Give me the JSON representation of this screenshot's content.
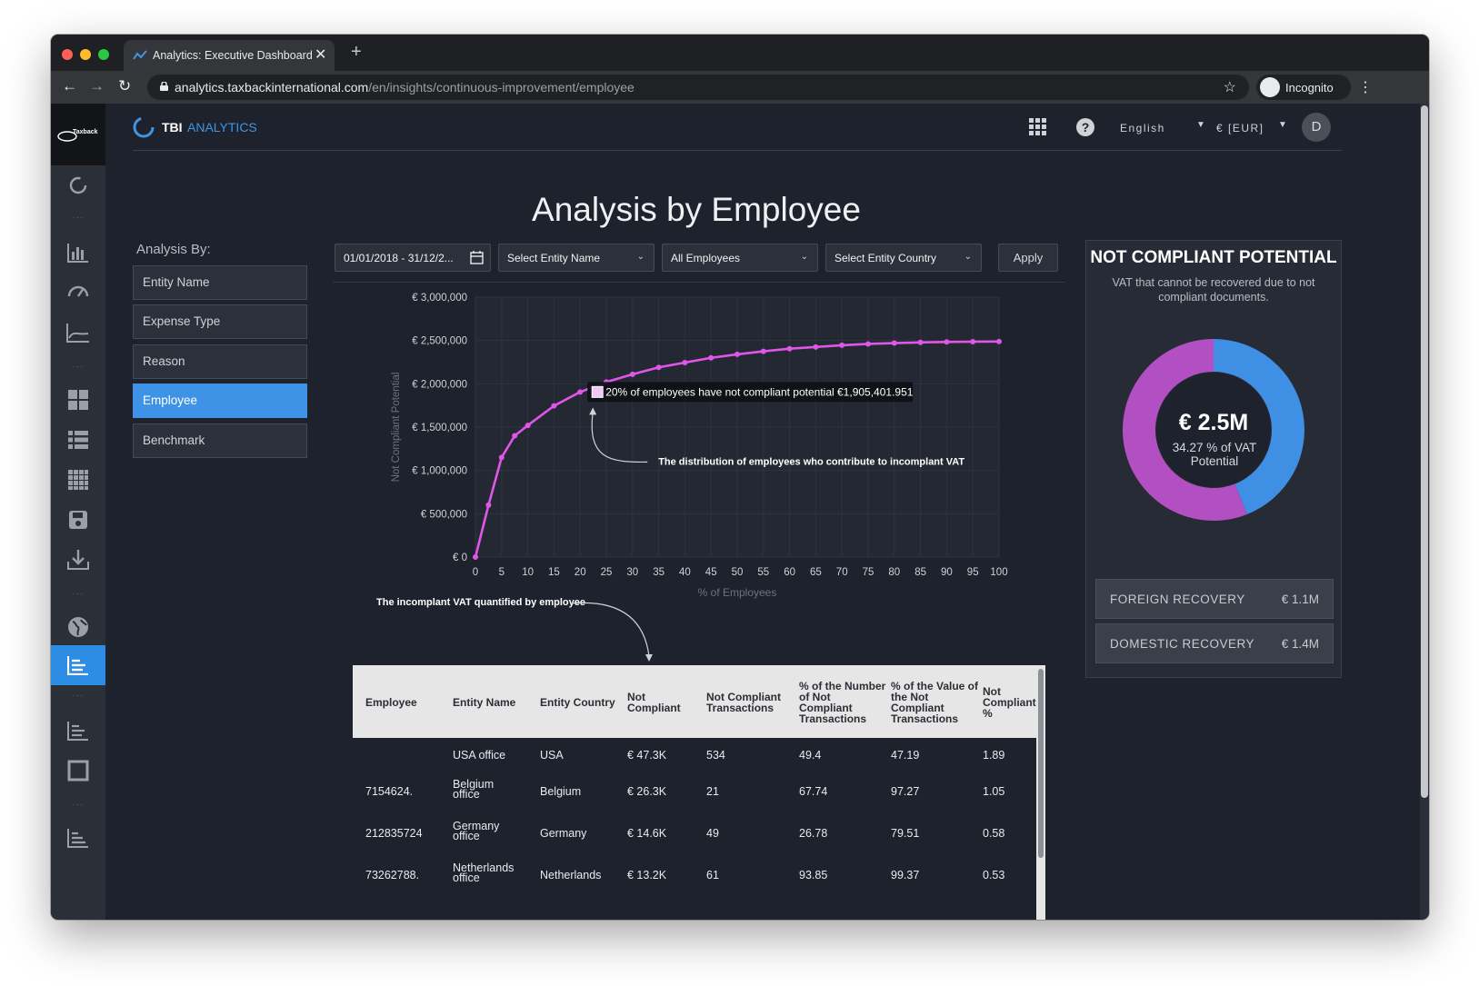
{
  "browser": {
    "tab_title": "Analytics: Executive Dashboard",
    "url_domain": "analytics.taxbackinternational.com",
    "url_path": "/en/insights/continuous-improvement/employee",
    "incognito_label": "Incognito"
  },
  "sidebar": {
    "logo_text": "Taxback"
  },
  "header": {
    "brand_tbi": "TBI",
    "brand_analytics": "ANALYTICS",
    "language": "English",
    "currency": "€ [EUR]",
    "avatar_initial": "D"
  },
  "page": {
    "title": "Analysis by Employee"
  },
  "analysis": {
    "label": "Analysis By:",
    "options": [
      {
        "label": "Entity Name",
        "active": false
      },
      {
        "label": "Expense Type",
        "active": false
      },
      {
        "label": "Reason",
        "active": false
      },
      {
        "label": "Employee",
        "active": true
      },
      {
        "label": "Benchmark",
        "active": false
      }
    ]
  },
  "filters": {
    "date_range": "01/01/2018 - 31/12/2...",
    "entity_name": "Select Entity Name",
    "employees": "All Employees",
    "entity_country": "Select Entity Country",
    "apply_label": "Apply"
  },
  "chart_data": {
    "type": "line",
    "title": "",
    "xlabel": "% of Employees",
    "ylabel": "Not Compliant Potential",
    "xlim": [
      0,
      100
    ],
    "ylim": [
      0,
      3000000
    ],
    "x_ticks": [
      0,
      5,
      10,
      15,
      20,
      25,
      30,
      35,
      40,
      45,
      50,
      55,
      60,
      65,
      70,
      75,
      80,
      85,
      90,
      95,
      100
    ],
    "y_tick_labels": [
      "€ 0",
      "€ 500,000",
      "€ 1,000,000",
      "€ 1,500,000",
      "€ 2,000,000",
      "€ 2,500,000",
      "€ 3,000,000"
    ],
    "y_ticks": [
      0,
      500000,
      1000000,
      1500000,
      2000000,
      2500000,
      3000000
    ],
    "grid": true,
    "color": "#e056e8",
    "x": [
      0,
      2.5,
      5,
      7.5,
      10,
      15,
      20,
      25,
      30,
      35,
      40,
      45,
      50,
      55,
      60,
      65,
      70,
      75,
      80,
      85,
      90,
      95,
      100
    ],
    "y": [
      0,
      600000,
      1150000,
      1400000,
      1520000,
      1745000,
      1905401.951,
      2020000,
      2110000,
      2190000,
      2245000,
      2300000,
      2340000,
      2375000,
      2405000,
      2425000,
      2445000,
      2460000,
      2470000,
      2478000,
      2483000,
      2486000,
      2488000
    ],
    "tooltip": "20% of employees have not compliant potential €1,905,401.951",
    "annotations": [
      "The distribution of employees who contribute to incomplant VAT",
      "The incomplant VAT quantified by employee"
    ]
  },
  "table": {
    "columns": [
      "Employee",
      "Entity Name",
      "Entity Country",
      "Not Compliant",
      "Not Compliant Transactions",
      "% of the Number of Not Compliant Transactions",
      "% of the Value of the Not Compliant Transactions",
      "Not Compliant %"
    ],
    "rows": [
      [
        "",
        "USA office",
        "USA",
        "€ 47.3K",
        "534",
        "49.4",
        "47.19",
        "1.89"
      ],
      [
        "7154624.",
        "Belgium office",
        "Belgium",
        "€ 26.3K",
        "21",
        "67.74",
        "97.27",
        "1.05"
      ],
      [
        "212835724",
        "Germany office",
        "Germany",
        "€ 14.6K",
        "49",
        "26.78",
        "79.51",
        "0.58"
      ],
      [
        "73262788.",
        "Netherlands office",
        "Netherlands",
        "€ 13.2K",
        "61",
        "93.85",
        "99.37",
        "0.53"
      ]
    ]
  },
  "panel": {
    "title": "NOT COMPLIANT POTENTIAL",
    "subtitle": "VAT that cannot be recovered due to not compliant documents.",
    "donut_value": "€ 2.5M",
    "donut_sub": "34.27 % of VAT Potential",
    "donut_segments": [
      {
        "name": "Foreign Recovery",
        "value": 1.1,
        "color": "#3f8fe4"
      },
      {
        "name": "Domestic Recovery",
        "value": 1.4,
        "color": "#b24fc2"
      }
    ],
    "foreign_label": "FOREIGN RECOVERY",
    "foreign_value": "€ 1.1M",
    "domestic_label": "DOMESTIC RECOVERY",
    "domestic_value": "€ 1.4M"
  }
}
